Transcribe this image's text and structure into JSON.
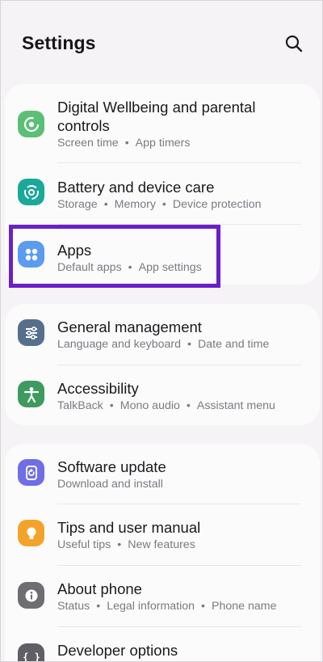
{
  "header": {
    "title": "Settings",
    "search_icon": "search-icon"
  },
  "groups": [
    {
      "items": [
        {
          "title_line1": "Digital Wellbeing and parental",
          "title_line2": "controls",
          "subs": [
            "Screen time",
            "App timers"
          ],
          "icon": "digital-wellbeing-icon",
          "color": "#5bbf76"
        },
        {
          "title": "Battery and device care",
          "subs": [
            "Storage",
            "Memory",
            "Device protection"
          ],
          "icon": "device-care-icon",
          "color": "#1aa89a"
        },
        {
          "title": "Apps",
          "subs": [
            "Default apps",
            "App settings"
          ],
          "icon": "apps-icon",
          "color": "#5b9bf0",
          "highlighted": true
        }
      ]
    },
    {
      "items": [
        {
          "title": "General management",
          "subs": [
            "Language and keyboard",
            "Date and time"
          ],
          "icon": "general-management-icon",
          "color": "#56708c"
        },
        {
          "title": "Accessibility",
          "subs": [
            "TalkBack",
            "Mono audio",
            "Assistant menu"
          ],
          "icon": "accessibility-icon",
          "color": "#3e9a5e"
        }
      ]
    },
    {
      "items": [
        {
          "title": "Software update",
          "subs": [
            "Download and install"
          ],
          "icon": "software-update-icon",
          "color": "#6f6ee6"
        },
        {
          "title": "Tips and user manual",
          "subs": [
            "Useful tips",
            "New features"
          ],
          "icon": "tips-icon",
          "color": "#f3a32b"
        },
        {
          "title": "About phone",
          "subs": [
            "Status",
            "Legal information",
            "Phone name"
          ],
          "icon": "about-phone-icon",
          "color": "#6d6d72"
        },
        {
          "title": "Developer options",
          "subs": [],
          "icon": "developer-options-icon",
          "color": "#5f5f65"
        }
      ]
    }
  ],
  "separator": "•",
  "highlight_color": "#6a1fc8"
}
